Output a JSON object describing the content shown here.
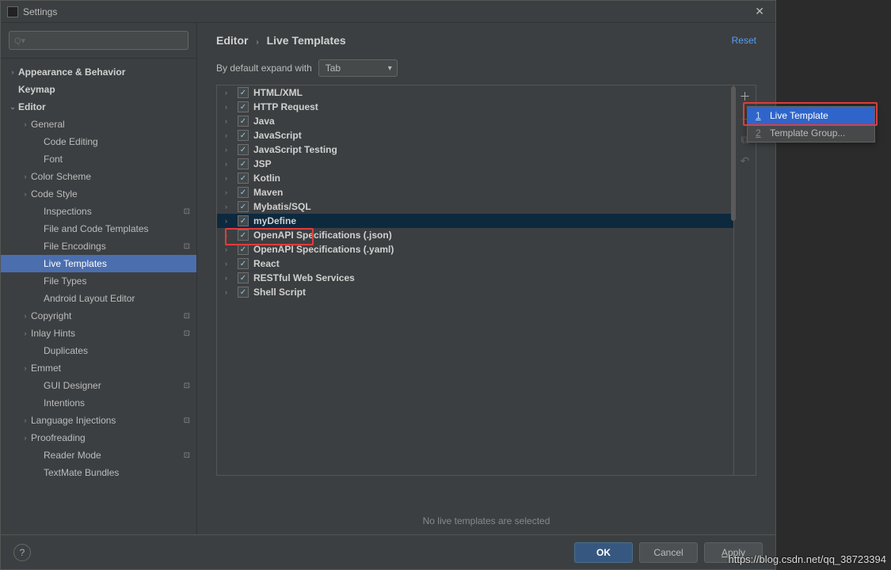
{
  "window": {
    "title": "Settings"
  },
  "search": {
    "placeholder": ""
  },
  "sidebar": {
    "items": [
      {
        "label": "Appearance & Behavior",
        "indent": 0,
        "arrow": "›",
        "bold": true
      },
      {
        "label": "Keymap",
        "indent": 0,
        "arrow": "",
        "bold": true
      },
      {
        "label": "Editor",
        "indent": 0,
        "arrow": "⌄",
        "bold": true
      },
      {
        "label": "General",
        "indent": 1,
        "arrow": "›"
      },
      {
        "label": "Code Editing",
        "indent": 2,
        "arrow": ""
      },
      {
        "label": "Font",
        "indent": 2,
        "arrow": ""
      },
      {
        "label": "Color Scheme",
        "indent": 1,
        "arrow": "›"
      },
      {
        "label": "Code Style",
        "indent": 1,
        "arrow": "›"
      },
      {
        "label": "Inspections",
        "indent": 2,
        "arrow": "",
        "badge": "⊡"
      },
      {
        "label": "File and Code Templates",
        "indent": 2,
        "arrow": ""
      },
      {
        "label": "File Encodings",
        "indent": 2,
        "arrow": "",
        "badge": "⊡"
      },
      {
        "label": "Live Templates",
        "indent": 2,
        "arrow": "",
        "selected": true
      },
      {
        "label": "File Types",
        "indent": 2,
        "arrow": ""
      },
      {
        "label": "Android Layout Editor",
        "indent": 2,
        "arrow": ""
      },
      {
        "label": "Copyright",
        "indent": 1,
        "arrow": "›",
        "badge": "⊡"
      },
      {
        "label": "Inlay Hints",
        "indent": 1,
        "arrow": "›",
        "badge": "⊡"
      },
      {
        "label": "Duplicates",
        "indent": 2,
        "arrow": ""
      },
      {
        "label": "Emmet",
        "indent": 1,
        "arrow": "›"
      },
      {
        "label": "GUI Designer",
        "indent": 2,
        "arrow": "",
        "badge": "⊡"
      },
      {
        "label": "Intentions",
        "indent": 2,
        "arrow": ""
      },
      {
        "label": "Language Injections",
        "indent": 1,
        "arrow": "›",
        "badge": "⊡"
      },
      {
        "label": "Proofreading",
        "indent": 1,
        "arrow": "›"
      },
      {
        "label": "Reader Mode",
        "indent": 2,
        "arrow": "",
        "badge": "⊡"
      },
      {
        "label": "TextMate Bundles",
        "indent": 2,
        "arrow": ""
      }
    ]
  },
  "breadcrumb": {
    "part1": "Editor",
    "part2": "Live Templates"
  },
  "reset": "Reset",
  "expand": {
    "label": "By default expand with",
    "value": "Tab"
  },
  "templates": [
    {
      "label": "HTML/XML"
    },
    {
      "label": "HTTP Request"
    },
    {
      "label": "Java"
    },
    {
      "label": "JavaScript"
    },
    {
      "label": "JavaScript Testing"
    },
    {
      "label": "JSP"
    },
    {
      "label": "Kotlin"
    },
    {
      "label": "Maven"
    },
    {
      "label": "Mybatis/SQL"
    },
    {
      "label": "myDefine",
      "selected": true
    },
    {
      "label": "OpenAPI Specifications (.json)"
    },
    {
      "label": "OpenAPI Specifications (.yaml)"
    },
    {
      "label": "React"
    },
    {
      "label": "RESTful Web Services"
    },
    {
      "label": "Shell Script"
    }
  ],
  "empty_msg": "No live templates are selected",
  "context_menu": [
    {
      "key": "1",
      "label": "Live Template",
      "selected": true
    },
    {
      "key": "2",
      "label": "Template Group..."
    }
  ],
  "footer": {
    "help": "?",
    "ok": "OK",
    "cancel": "Cancel",
    "apply": "Apply"
  },
  "watermark": "https://blog.csdn.net/qq_38723394"
}
